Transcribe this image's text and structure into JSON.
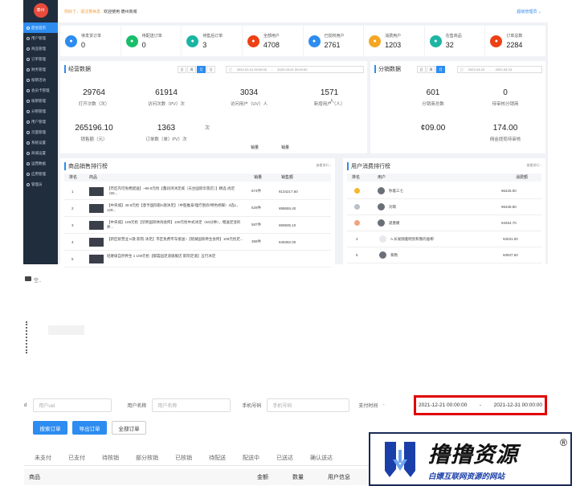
{
  "sidebar": {
    "logo": "泰州",
    "items": [
      "后台首页",
      "用户管理",
      "商品管理",
      "订单管理",
      "财务管理",
      "核销活动",
      "会员卡管理",
      "核销管理",
      "分销管理",
      "用户管理",
      "页面管理",
      "系统设置",
      "商城设置",
      "运营数据",
      "应用管理",
      "管理员"
    ]
  },
  "topbar": {
    "greeting": "你好了，请注意休息",
    "welcome": "欢迎使用 德州商城",
    "user": "超级管理员 ⌄"
  },
  "cards": [
    {
      "label": "待发货订单",
      "value": "0",
      "color": "#2d8cf0",
      "icon": "box-icon"
    },
    {
      "label": "待配送订单",
      "value": "0",
      "color": "#19be6b",
      "icon": "truck-icon"
    },
    {
      "label": "待售后订单",
      "value": "3",
      "color": "#1cb5a3",
      "icon": "service-icon"
    },
    {
      "label": "全部用户",
      "value": "4708",
      "color": "#ed4014",
      "icon": "user-icon"
    },
    {
      "label": "已授权用户",
      "value": "2761",
      "color": "#2d8cf0",
      "icon": "auth-icon"
    },
    {
      "label": "消费用户",
      "value": "1203",
      "color": "#f5a623",
      "icon": "coin-icon"
    },
    {
      "label": "在售商品",
      "value": "32",
      "color": "#1cb5a3",
      "icon": "bag-icon"
    },
    {
      "label": "订单总数",
      "value": "2284",
      "color": "#ed4014",
      "icon": "order-icon"
    }
  ],
  "ops": {
    "title": "经营数据",
    "segments": [
      "日",
      "周",
      "月",
      "日"
    ],
    "date_from": "2022-02-01 00:00:00",
    "date_to": "2022-03-01 00:00:00",
    "stats": [
      {
        "value": "29764",
        "label": "打开次数（次）"
      },
      {
        "value": "61914",
        "label": "访问次数（PV）次"
      },
      {
        "value": "3034",
        "label": "访问用户（UV）人"
      },
      {
        "value": "1571",
        "label": "新增用户（人）"
      },
      {
        "value": "265196.10",
        "label": "销售额（元）"
      },
      {
        "value": "1363",
        "label": "订单数（单）PV）次"
      }
    ]
  },
  "dist": {
    "title": "分销数据",
    "segments": [
      "日",
      "周",
      "月"
    ],
    "date_from": "2022-03-23",
    "date_to": "2022-03-23",
    "stats": [
      {
        "value": "601",
        "label": "分销商总数"
      },
      {
        "value": "0",
        "label": "待审核分销商"
      },
      {
        "value": "¢09.00",
        "label": ""
      },
      {
        "value": "174.00",
        "label": "佣金提现待审核"
      }
    ],
    "partial_a": "次",
    "partial_b": "人"
  },
  "header_cells": [
    "销量",
    "销量"
  ],
  "product_rank": {
    "title": "商品销售排行榜",
    "more": "查看排行 ›",
    "columns": [
      "排名",
      "商品",
      "销量",
      "销售额"
    ],
    "rows": [
      {
        "rank": "1",
        "name": "【市区内可免费配送】~99.9元抢【鑫润湾沐足城（天台国际华景店）】精选·尚足（60...",
        "sales": "674件",
        "amount": "¥134217.60"
      },
      {
        "rank": "2",
        "name": "【中央城】49.9元抢【意亨国际影K歌沐足】（中医推拿/理疗刮痧/特色修脚）3选1，129...",
        "sales": "629件",
        "amount": "¥98655.40"
      },
      {
        "rank": "3",
        "name": "【中央城】109元抢【华熙国际休闲会所】109元抢中式沐足（60分钟），赠送足浴的养...",
        "sales": "587件",
        "amount": "¥59835.10"
      },
      {
        "rank": "4",
        "name": "【新区统营业 K歌·影院·沐足】市区免费专车接送~【铭湖国际养生会所】109元抢足...",
        "sales": "358件",
        "amount": "¥49392.00"
      },
      {
        "rank": "5",
        "name": "轻奢级自然养生 1 109元抢【都荟园足道旗舰店 影院足道】五行沐足",
        "sales": "",
        "amount": ""
      }
    ]
  },
  "user_rank": {
    "title": "用户消费排行榜",
    "more": "查看排行 ›",
    "columns": [
      "排名",
      "用户",
      "消费额"
    ],
    "rows": [
      {
        "rank": "1",
        "name": "秒着三七",
        "amount": "¥6425.00",
        "medal": "#f5b82e"
      },
      {
        "rank": "2",
        "name": "刘萌",
        "amount": "¥6348.80",
        "medal": "#b9c1c9"
      },
      {
        "rank": "3",
        "name": "遂墨婕",
        "amount": "¥4454.70",
        "medal": "#f0a57e"
      },
      {
        "rank": "4",
        "name": "A.长发随着明亮和我的垂柳",
        "amount": "¥4031.00",
        "medal": ""
      },
      {
        "rank": "5",
        "name": "蒋勒",
        "amount": "¥3937.60",
        "medal": ""
      }
    ]
  },
  "snippet": {
    "label": "空.."
  },
  "filters": {
    "uid_placeholder": "用户uid",
    "name_label": "用户名称",
    "name_placeholder": "用户名称",
    "phone_label": "手机号码",
    "phone_placeholder": "手机号码",
    "time_label": "支付时间",
    "time_from": "2021-12-21 00:00:00",
    "time_sep": "-",
    "time_to": "2021-12-31 00:00:00",
    "highlight_color": "#e00000"
  },
  "buttons": {
    "search": "搜索订单",
    "export": "导出订单",
    "all": "全部订单"
  },
  "status_tabs": [
    "未支付",
    "已支付",
    "待核销",
    "部分核销",
    "已核销",
    "待配送",
    "配送中",
    "已送达",
    "确认送达"
  ],
  "list_header": [
    "商品",
    "金额",
    "数量",
    "用户信息"
  ],
  "watermark": {
    "title": "撸撸资源",
    "subtitle": "白嫖互联网资源的网站",
    "reg": "®"
  }
}
